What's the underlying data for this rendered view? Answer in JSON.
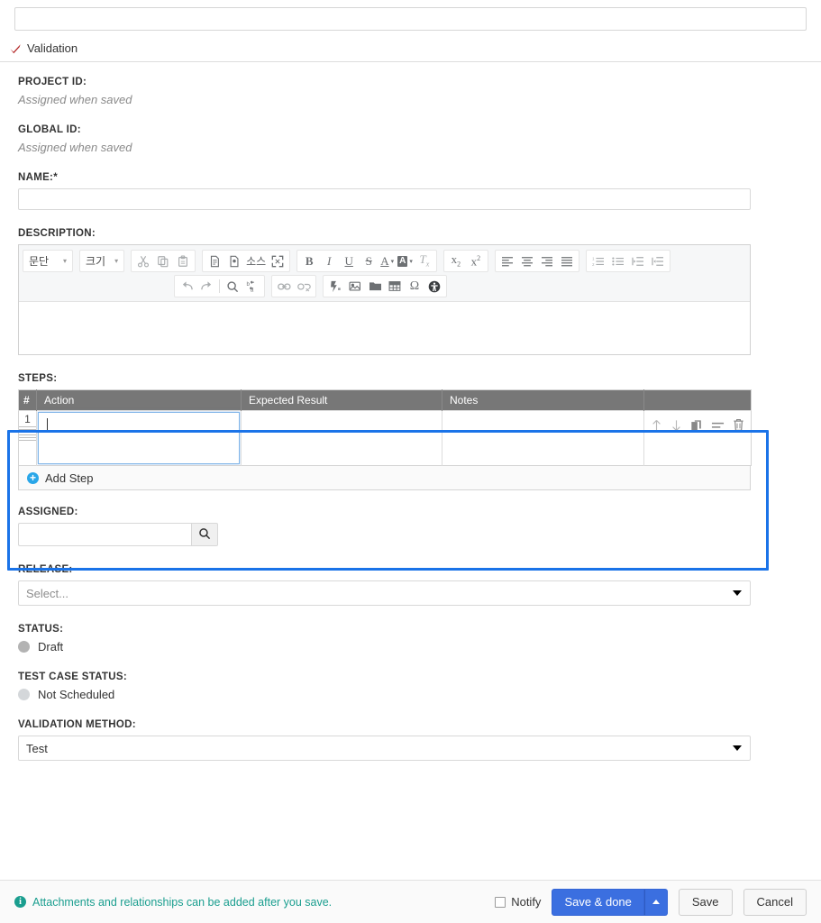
{
  "top": {
    "title_input_value": "",
    "title_input_placeholder": "",
    "tabs": [
      {
        "label": "Validation",
        "icon": "red-check-icon"
      }
    ]
  },
  "form": {
    "project_id": {
      "label": "PROJECT ID:",
      "value": "Assigned when saved"
    },
    "global_id": {
      "label": "GLOBAL ID:",
      "value": "Assigned when saved"
    },
    "name": {
      "label": "NAME:*",
      "value": "",
      "placeholder": ""
    },
    "description": {
      "label": "DESCRIPTION:",
      "value": ""
    },
    "steps": {
      "label": "STEPS:"
    },
    "assigned": {
      "label": "ASSIGNED:",
      "value": "",
      "placeholder": ""
    },
    "release": {
      "label": "RELEASE:",
      "value": "Select...",
      "is_placeholder": true
    },
    "status": {
      "label": "STATUS:",
      "value": "Draft"
    },
    "test_case_status": {
      "label": "TEST CASE STATUS:",
      "value": "Not Scheduled"
    },
    "validation_method": {
      "label": "VALIDATION METHOD:",
      "value": "Test"
    }
  },
  "editor": {
    "paragraph_combo": "문단",
    "size_combo": "크기",
    "source_label": "소스",
    "combo_arrow": "▾",
    "toolbar_row1": [
      "cut-icon",
      "copy-icon",
      "paste-icon",
      "paste-text-icon",
      "paste-word-icon",
      "source-icon",
      "maximize-icon",
      "bold-icon",
      "italic-icon",
      "underline-icon",
      "strikethrough-icon",
      "text-color-icon",
      "background-color-icon",
      "remove-format-icon",
      "subscript-icon",
      "superscript-icon",
      "align-left-icon",
      "align-center-icon",
      "align-right-icon",
      "justify-icon",
      "numbered-list-icon",
      "bulleted-list-icon",
      "outdent-icon",
      "indent-icon"
    ],
    "toolbar_row2": [
      "undo-icon",
      "redo-icon",
      "find-icon",
      "replace-icon",
      "link-icon",
      "unlink-icon",
      "flash-icon",
      "image-icon",
      "template-icon",
      "table-icon",
      "special-char-icon",
      "accessibility-icon"
    ],
    "content": ""
  },
  "steps_table": {
    "columns": [
      "#",
      "Action",
      "Expected Result",
      "Notes",
      ""
    ],
    "rows": [
      {
        "number": "1",
        "action": "",
        "expected_result": "",
        "notes": "",
        "ops": [
          "move-up-icon",
          "move-down-icon",
          "duplicate-icon",
          "insert-icon",
          "delete-icon"
        ]
      }
    ],
    "add_step_label": "Add Step"
  },
  "footer": {
    "info_text": "Attachments and relationships can be added after you save.",
    "info_icon": "info-icon",
    "notify_label": "Notify",
    "notify_checked": false,
    "save_done_label": "Save & done",
    "save_label": "Save",
    "cancel_label": "Cancel"
  },
  "colors": {
    "highlight_border": "#1a73e8",
    "primary_button": "#3b6fe0",
    "info_teal": "#1a9e8f",
    "table_header": "#777777",
    "check_red": "#b22222",
    "add_blue": "#29a6e8"
  }
}
